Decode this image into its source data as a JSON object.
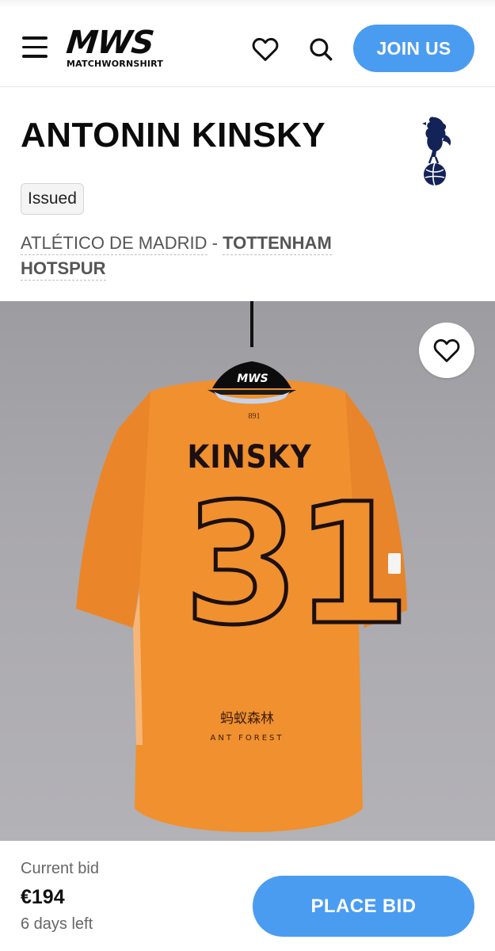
{
  "header": {
    "logo_mark": "MWS",
    "logo_sub": "MATCHWORNSHIRT",
    "join_label": "JOIN US",
    "icons": [
      "menu-icon",
      "heart-icon",
      "search-icon"
    ]
  },
  "product": {
    "player_name": "ANTONIN KINSKY",
    "badge": "Issued",
    "home_team": "ATLÉTICO DE MADRID",
    "separator": " - ",
    "away_team": "TOTTENHAM HOTSPUR",
    "club_crest": "tottenham-crest-icon"
  },
  "shirt": {
    "hanger_logo": "MWS",
    "collar_text": "891",
    "name": "KINSKY",
    "number": "31",
    "sponsor_cn": "蚂蚁森林",
    "sponsor_en": "ANT FOREST",
    "color": "#f0902f"
  },
  "bid": {
    "label": "Current bid",
    "amount": "€194",
    "time_left": "6 days left",
    "cta": "PLACE BID"
  },
  "colors": {
    "accent": "#4a9cf1",
    "text": "#111111",
    "muted": "#666666"
  }
}
